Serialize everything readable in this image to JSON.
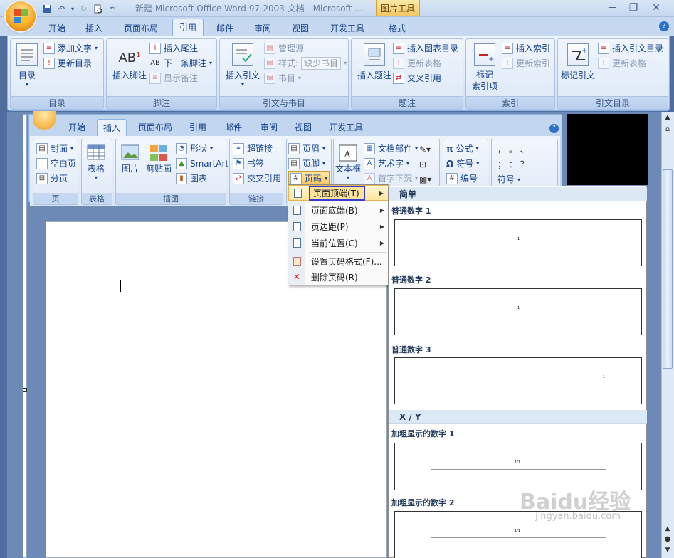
{
  "window": {
    "title": "新建 Microsoft Office Word 97-2003 文档 - Microsoft ...",
    "context_tab": "图片工具",
    "controls": [
      "－",
      "❐",
      "✕"
    ]
  },
  "tabs": [
    "开始",
    "插入",
    "页面布局",
    "引用",
    "邮件",
    "审阅",
    "视图",
    "开发工具",
    "格式"
  ],
  "active_tab": "引用",
  "ribbon": {
    "toc": {
      "big": "目录",
      "add_text": "添加文字",
      "update": "更新目录",
      "title": "目录"
    },
    "footnotes": {
      "insert": "插入脚注",
      "endnote": "插入尾注",
      "next": "下一条脚注",
      "show": "显示备注",
      "title": "脚注"
    },
    "citations": {
      "insert": "插入引文",
      "manage": "管理源",
      "style_label": "样式:",
      "style_value": "缺少书目",
      "bib": "书目",
      "title": "引文与书目"
    },
    "captions": {
      "insert": "插入题注",
      "table_fig": "插入图表目录",
      "update": "更新表格",
      "cross": "交叉引用",
      "title": "题注"
    },
    "index": {
      "mark": "标记\n索引项",
      "insert": "插入索引",
      "update": "更新索引",
      "title": "索引"
    },
    "toa": {
      "mark": "标记引文",
      "insert": "插入引文目录",
      "update": "更新表格",
      "title": "引文目录"
    }
  },
  "inner": {
    "tabs": [
      "开始",
      "插入",
      "页面布局",
      "引用",
      "邮件",
      "审阅",
      "视图",
      "开发工具"
    ],
    "active": "插入",
    "pages": {
      "cover": "封面",
      "blank": "空白页",
      "break": "分页",
      "title": "页"
    },
    "table": {
      "label": "表格",
      "title": "表格"
    },
    "illus": {
      "pic": "图片",
      "clip": "剪贴画",
      "shape": "形状",
      "smartart": "SmartArt",
      "chart": "图表",
      "title": "插图"
    },
    "links": {
      "hyper": "超链接",
      "bookmark": "书签",
      "cross": "交叉引用",
      "title": "链接"
    },
    "hf": {
      "header": "页眉",
      "footer": "页脚",
      "pagenum": "页码"
    },
    "text": {
      "textbox": "文本框",
      "parts": "文档部件",
      "wordart": "艺术字",
      "dropcap": "首字下沉"
    },
    "symbols": {
      "eq": "公式",
      "sym": "符号",
      "num": "编号"
    },
    "special": {
      "r1": "，  。  、",
      "r2": "；  ：  ？",
      "sym": "符号"
    }
  },
  "menu": [
    {
      "label": "页面顶端(T)",
      "arrow": true
    },
    {
      "label": "页面底端(B)",
      "arrow": true
    },
    {
      "label": "页边距(P)",
      "arrow": true
    },
    {
      "label": "当前位置(C)",
      "arrow": true
    },
    {
      "label": "设置页码格式(F)...",
      "arrow": false
    },
    {
      "label": "删除页码(R)",
      "arrow": false
    }
  ],
  "gallery": {
    "section1": "简单",
    "items1": [
      "普通数字 1",
      "普通数字 2",
      "普通数字 3"
    ],
    "section2": "X / Y",
    "items2": [
      "加粗显示的数字 1",
      "加粗显示的数字 2"
    ],
    "sample_num": "1",
    "sample_xy": "1/1"
  },
  "watermark": {
    "brand": "Baidu经验",
    "url": "jingyan.baidu.com"
  }
}
